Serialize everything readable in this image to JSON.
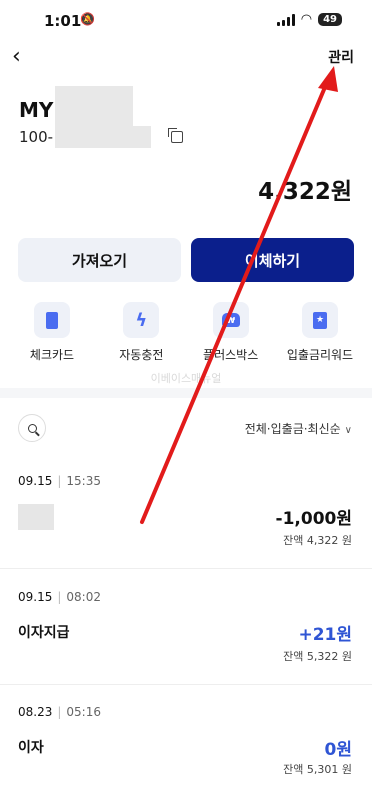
{
  "status_bar": {
    "time": "1:01",
    "battery": "49"
  },
  "nav": {
    "manage_label": "관리"
  },
  "account": {
    "name_prefix": "MY",
    "number_prefix": "100-"
  },
  "balance": "4,322원",
  "actions": {
    "import_label": "가져오기",
    "transfer_label": "이체하기"
  },
  "quick_menu": [
    {
      "label": "체크카드",
      "icon": "card-icon"
    },
    {
      "label": "자동충전",
      "icon": "bolt-icon"
    },
    {
      "label": "플러스박스",
      "icon": "box-icon"
    },
    {
      "label": "입출금리워드",
      "icon": "reward-icon"
    }
  ],
  "watermark": "이베이스매뉴얼",
  "filter": {
    "label": "전체·입출금·최신순"
  },
  "transactions": [
    {
      "date": "09.15",
      "time": "15:35",
      "desc": "",
      "amount": "-1,000원",
      "balance": "잔액 4,322 원"
    },
    {
      "date": "09.15",
      "time": "08:02",
      "desc": "이자지급",
      "amount": "+21원",
      "balance": "잔액 5,322 원"
    },
    {
      "date": "08.23",
      "time": "05:16",
      "desc": "이자",
      "amount": "0원",
      "balance": "잔액 5,301 원"
    }
  ],
  "colors": {
    "primary": "#0b1f8c",
    "accent": "#2f55d4",
    "icon_blue": "#4a6cf0",
    "annotation_arrow": "#e21b1b"
  }
}
